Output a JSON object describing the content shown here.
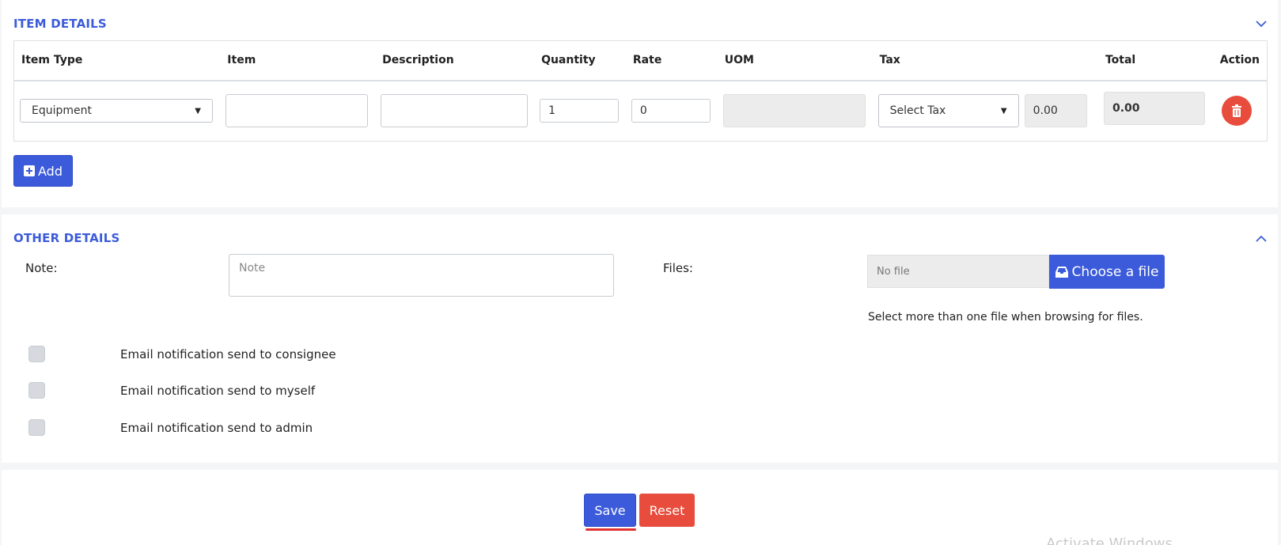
{
  "item_details": {
    "title": "ITEM DETAILS",
    "columns": [
      "Item Type",
      "Item",
      "Description",
      "Quantity",
      "Rate",
      "UOM",
      "Tax",
      "Total",
      "Action"
    ],
    "row": {
      "item_type": "Equipment",
      "item": "",
      "description": "",
      "quantity": "1",
      "rate": "0",
      "uom": "",
      "tax_select": "Select Tax",
      "tax_amount": "0.00",
      "total": "0.00"
    },
    "add_label": "Add"
  },
  "other_details": {
    "title": "OTHER DETAILS",
    "note_label": "Note:",
    "note_placeholder": "Note",
    "files_label": "Files:",
    "file_status": "No file",
    "choose_file_label": "Choose a file",
    "files_hint": "Select more than one file when browsing for files.",
    "notifications": [
      "Email notification send to consignee",
      "Email notification send to myself",
      "Email notification send to admin"
    ]
  },
  "actions": {
    "save_label": "Save",
    "reset_label": "Reset"
  },
  "watermark": "Activate Windows",
  "colors": {
    "primary": "#3b5bdb",
    "danger": "#e74c3c",
    "readonly_bg": "#ececec"
  },
  "icons": [
    "chevron-down-icon",
    "chevron-up-icon",
    "trash-icon",
    "plus-square-icon",
    "inbox-icon"
  ]
}
